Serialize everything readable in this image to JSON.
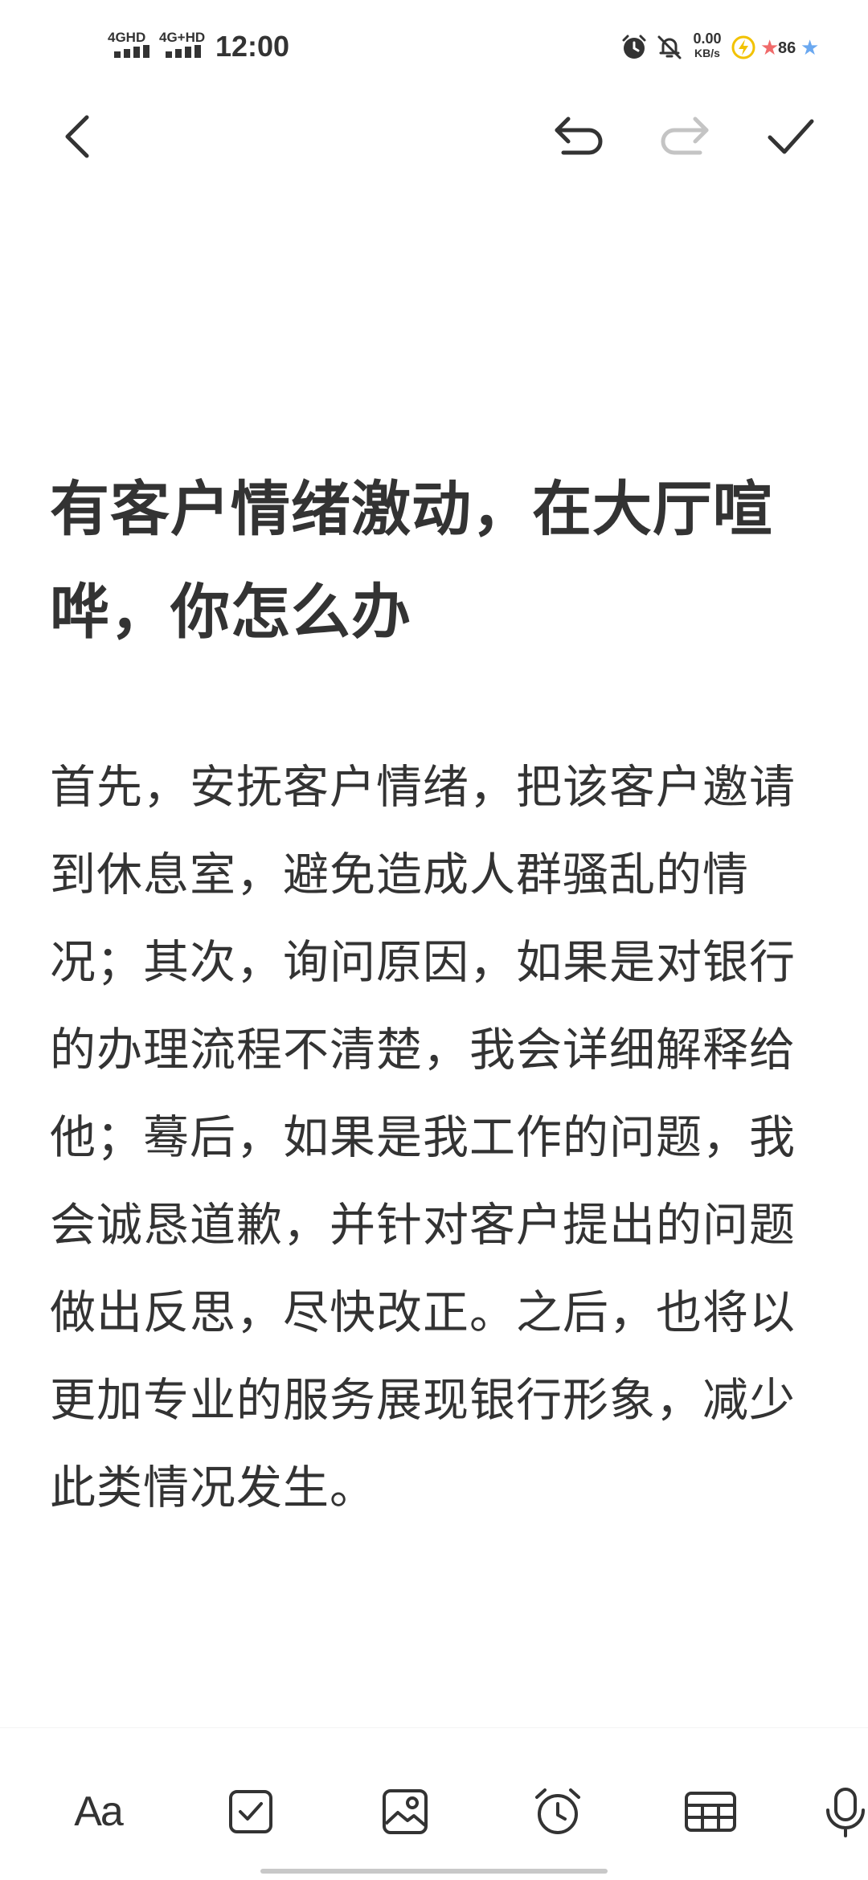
{
  "status_bar": {
    "signal_1": "4GHD",
    "signal_2": "4G+HD",
    "time": "12:00",
    "net_speed_value": "0.00",
    "net_speed_unit": "KB/s",
    "battery_level": "86"
  },
  "note": {
    "title": "有客户情绪激动，在大厅喧哗，你怎么办",
    "body": "首先，安抚客户情绪，把该客户邀请到休息室，避免造成人群骚乱的情况；其次，询问原因，如果是对银行的办理流程不清楚，我会详细解释给他；蓦后，如果是我工作的问题，我会诚恳道歉，并针对客户提出的问题做出反思，尽快改正。之后，也将以更加专业的服务展现银行形象，减少此类情况发生。"
  },
  "bottom_toolbar": {
    "format_label": "Aa"
  },
  "icons": {
    "back": "chevron-left-icon",
    "undo": "undo-icon",
    "redo": "redo-icon",
    "done": "check-icon",
    "checklist": "checkbox-icon",
    "image": "image-icon",
    "alarm": "alarm-clock-icon",
    "table": "table-icon",
    "mic": "microphone-icon"
  },
  "colors": {
    "text": "#333333",
    "disabled": "#c4c4c4",
    "home_indicator": "#c8c8c8"
  }
}
